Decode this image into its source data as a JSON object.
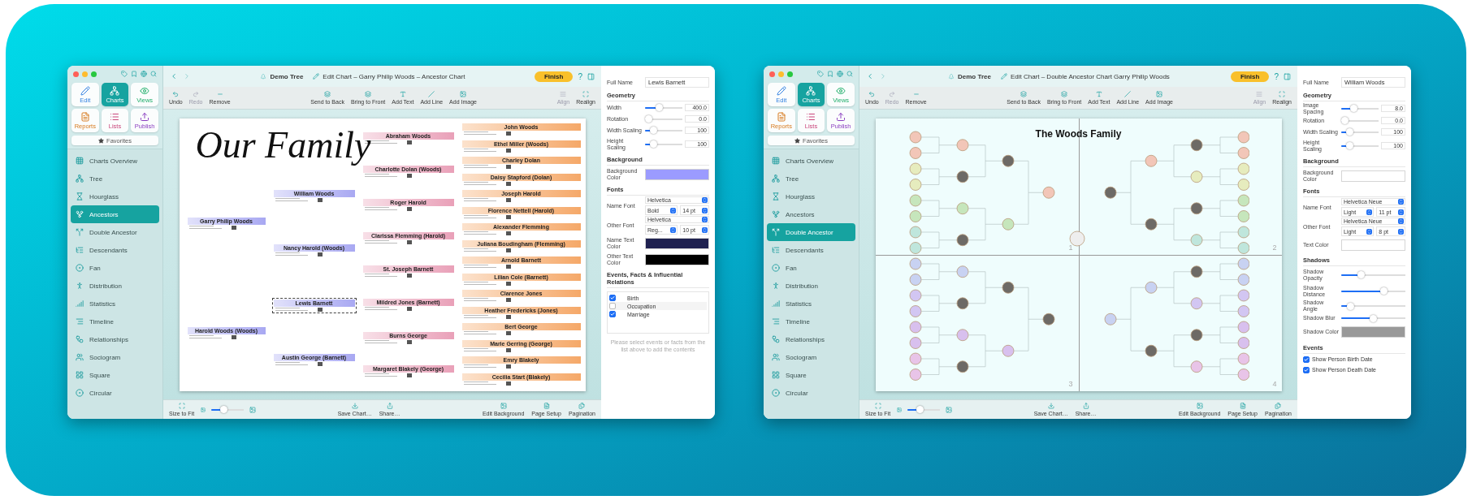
{
  "windows": [
    {
      "tree": "Demo Tree",
      "title": "Edit Chart – Garry Philip Woods – Ancestor Chart",
      "finish": "Finish",
      "help": "?",
      "modules": [
        {
          "label": "Edit",
          "selected": false
        },
        {
          "label": "Charts",
          "selected": true
        },
        {
          "label": "Views",
          "selected": false
        },
        {
          "label": "Reports",
          "selected": false
        },
        {
          "label": "Lists",
          "selected": false
        },
        {
          "label": "Publish",
          "selected": false
        }
      ],
      "favorites": "Favorites",
      "sidebar": {
        "items": [
          {
            "label": "Charts Overview",
            "selected": false
          },
          {
            "label": "Tree",
            "selected": false
          },
          {
            "label": "Hourglass",
            "selected": false
          },
          {
            "label": "Ancestors",
            "selected": true
          },
          {
            "label": "Double Ancestor",
            "selected": false
          },
          {
            "label": "Descendants",
            "selected": false
          },
          {
            "label": "Fan",
            "selected": false
          },
          {
            "label": "Distribution",
            "selected": false
          },
          {
            "label": "Statistics",
            "selected": false
          },
          {
            "label": "Timeline",
            "selected": false
          },
          {
            "label": "Relationships",
            "selected": false
          },
          {
            "label": "Sociogram",
            "selected": false
          },
          {
            "label": "Square",
            "selected": false
          },
          {
            "label": "Circular",
            "selected": false
          }
        ]
      },
      "toolbar": {
        "left": [
          {
            "label": "Undo",
            "disabled": false
          },
          {
            "label": "Redo",
            "disabled": true
          },
          {
            "label": "Remove",
            "disabled": false
          }
        ],
        "center": [
          {
            "label": "Send to Back",
            "disabled": false
          },
          {
            "label": "Bring to Front",
            "disabled": false
          },
          {
            "label": "Add Text",
            "disabled": false
          },
          {
            "label": "Add Line",
            "disabled": false
          },
          {
            "label": "Add Image",
            "disabled": false
          }
        ],
        "right": [
          {
            "label": "Align",
            "disabled": true
          },
          {
            "label": "Realign",
            "disabled": false
          }
        ]
      },
      "chart": {
        "kind": "ancestor",
        "title": "Our Family",
        "generations": [
          [
            {
              "name": "Garry Philip Woods",
              "selected": false
            },
            {
              "name": "Harold Woods (Woods)",
              "selected": false
            }
          ],
          [
            {
              "name": "William Woods",
              "selected": false
            },
            {
              "name": "Nancy Harold (Woods)",
              "selected": false
            },
            {
              "name": "Lewis Barnett",
              "selected": true
            },
            {
              "name": "Austin George (Barnett)",
              "selected": false
            }
          ],
          [
            {
              "name": "Abraham Woods",
              "selected": false
            },
            {
              "name": "Charlotte Dolan (Woods)",
              "selected": false
            },
            {
              "name": "Roger Harold",
              "selected": false
            },
            {
              "name": "Clarissa Flemming (Harold)",
              "selected": false
            },
            {
              "name": "St. Joseph Barnett",
              "selected": false
            },
            {
              "name": "Mildred Jones (Barnett)",
              "selected": false
            },
            {
              "name": "Burns George",
              "selected": false
            },
            {
              "name": "Margaret Blakely (George)",
              "selected": false
            }
          ],
          [
            {
              "name": "John Woods",
              "selected": false
            },
            {
              "name": "Ethel Miller (Woods)",
              "selected": false
            },
            {
              "name": "Charley Dolan",
              "selected": false
            },
            {
              "name": "Daisy Stapford (Dolan)",
              "selected": false
            },
            {
              "name": "Joseph Harold",
              "selected": false
            },
            {
              "name": "Florence Nettell (Harold)",
              "selected": false
            },
            {
              "name": "Alexander Flemming",
              "selected": false
            },
            {
              "name": "Juliana Boudingham (Flemming)",
              "selected": false
            },
            {
              "name": "Arnold Barnett",
              "selected": false
            },
            {
              "name": "Lilian Cole (Barnett)",
              "selected": false
            },
            {
              "name": "Clarence Jones",
              "selected": false
            },
            {
              "name": "Heather Fredericks (Jones)",
              "selected": false
            },
            {
              "name": "Bert George",
              "selected": false
            },
            {
              "name": "Marie Gerring (George)",
              "selected": false
            },
            {
              "name": "Emry Blakely",
              "selected": false
            },
            {
              "name": "Cecilia Start (Blakely)",
              "selected": false
            }
          ]
        ]
      },
      "bottom": {
        "fit": "Size to Fit",
        "zoom": {
          "level": 0.35
        },
        "center": [
          "Save Chart…",
          "Share…"
        ],
        "right": [
          "Edit Background",
          "Page Setup",
          "Pagination"
        ]
      },
      "inspector": {
        "full_name_label": "Full Name",
        "full_name": "Lewis Barnett",
        "sections": [
          {
            "title": "Geometry",
            "rows": [
              {
                "kind": "slider",
                "label": "Width",
                "level": 0.35,
                "value": "400.0"
              },
              {
                "kind": "slider",
                "label": "Rotation",
                "level": 0,
                "value": "0.0"
              },
              {
                "kind": "slider",
                "label": "Width Scaling",
                "level": 0.15,
                "value": "100"
              },
              {
                "kind": "slider",
                "label": "Height Scaling",
                "level": 0.15,
                "value": "100"
              }
            ]
          },
          {
            "title": "Background",
            "rows": [
              {
                "kind": "color",
                "label": "Background Color",
                "color": "#9b9bff"
              }
            ]
          },
          {
            "title": "Fonts",
            "rows": [
              {
                "kind": "font",
                "label": "Name Font",
                "family": "Helvetica",
                "style": "Bold",
                "size": "14 pt"
              },
              {
                "kind": "font",
                "label": "Other Font",
                "family": "Helvetica",
                "style": "Reg...",
                "size": "10 pt"
              },
              {
                "kind": "color",
                "label": "Name Text Color",
                "color": "#1f2150"
              },
              {
                "kind": "color",
                "label": "Other Text Color",
                "color": "#000000"
              }
            ]
          },
          {
            "title": "Events, Facts & Influential Relations",
            "rows": [
              {
                "kind": "checklist",
                "items": [
                  {
                    "label": "Birth",
                    "checked": true
                  },
                  {
                    "label": "Occupation",
                    "checked": false
                  },
                  {
                    "label": "Marriage",
                    "checked": true
                  }
                ]
              },
              {
                "kind": "note",
                "text": "Please select events or facts from the list above to add the contents"
              }
            ]
          }
        ]
      }
    },
    {
      "tree": "Demo Tree",
      "title": "Edit Chart – Double Ancestor Chart Garry Philip Woods",
      "finish": "Finish",
      "help": "?",
      "modules": [
        {
          "label": "Edit",
          "selected": false
        },
        {
          "label": "Charts",
          "selected": true
        },
        {
          "label": "Views",
          "selected": false
        },
        {
          "label": "Reports",
          "selected": false
        },
        {
          "label": "Lists",
          "selected": false
        },
        {
          "label": "Publish",
          "selected": false
        }
      ],
      "favorites": "Favorites",
      "sidebar": {
        "items": [
          {
            "label": "Charts Overview",
            "selected": false
          },
          {
            "label": "Tree",
            "selected": false
          },
          {
            "label": "Hourglass",
            "selected": false
          },
          {
            "label": "Ancestors",
            "selected": false
          },
          {
            "label": "Double Ancestor",
            "selected": true
          },
          {
            "label": "Descendants",
            "selected": false
          },
          {
            "label": "Fan",
            "selected": false
          },
          {
            "label": "Distribution",
            "selected": false
          },
          {
            "label": "Statistics",
            "selected": false
          },
          {
            "label": "Timeline",
            "selected": false
          },
          {
            "label": "Relationships",
            "selected": false
          },
          {
            "label": "Sociogram",
            "selected": false
          },
          {
            "label": "Square",
            "selected": false
          },
          {
            "label": "Circular",
            "selected": false
          }
        ]
      },
      "toolbar": {
        "left": [
          {
            "label": "Undo",
            "disabled": false
          },
          {
            "label": "Redo",
            "disabled": true
          },
          {
            "label": "Remove",
            "disabled": false
          }
        ],
        "center": [
          {
            "label": "Send to Back",
            "disabled": false
          },
          {
            "label": "Bring to Front",
            "disabled": false
          },
          {
            "label": "Add Text",
            "disabled": false
          },
          {
            "label": "Add Line",
            "disabled": false
          },
          {
            "label": "Add Image",
            "disabled": false
          }
        ],
        "right": [
          {
            "label": "Align",
            "disabled": true
          },
          {
            "label": "Realign",
            "disabled": false
          }
        ]
      },
      "chart": {
        "kind": "double_ancestor",
        "title": "The Woods Family",
        "quadrants": [
          "1",
          "2",
          "3",
          "4"
        ]
      },
      "bottom": {
        "fit": "Size to Fit",
        "zoom": {
          "level": 0.35
        },
        "center": [
          "Save Chart…",
          "Share…"
        ],
        "right": [
          "Edit Background",
          "Page Setup",
          "Pagination"
        ]
      },
      "inspector": {
        "full_name_label": "Full Name",
        "full_name": "William Woods",
        "sections": [
          {
            "title": "Geometry",
            "rows": [
              {
                "kind": "slider",
                "label": "Image Spacing",
                "level": 0.3,
                "value": "8.0"
              },
              {
                "kind": "slider",
                "label": "Rotation",
                "level": 0,
                "value": "0.0"
              },
              {
                "kind": "slider",
                "label": "Width Scaling",
                "level": 0.15,
                "value": "100"
              },
              {
                "kind": "slider",
                "label": "Height Scaling",
                "level": 0.15,
                "value": "100"
              }
            ]
          },
          {
            "title": "Background",
            "rows": [
              {
                "kind": "color",
                "label": "Background Color",
                "color": "#ffffff"
              }
            ]
          },
          {
            "title": "Fonts",
            "rows": [
              {
                "kind": "font",
                "label": "Name Font",
                "family": "Helvetica Neue",
                "style": "Light",
                "size": "11 pt"
              },
              {
                "kind": "font",
                "label": "Other Font",
                "family": "Helvetica Neue",
                "style": "Light",
                "size": "8 pt"
              },
              {
                "kind": "color",
                "label": "Text Color",
                "color": "#ffffff"
              }
            ]
          },
          {
            "title": "Shadows",
            "rows": [
              {
                "kind": "slider",
                "label": "Shadow Opacity",
                "level": 0.28
              },
              {
                "kind": "slider",
                "label": "Shadow Distance",
                "level": 0.68
              },
              {
                "kind": "slider",
                "label": "Shadow Angle",
                "level": 0.1
              },
              {
                "kind": "slider",
                "label": "Shadow Blur",
                "level": 0.5
              },
              {
                "kind": "color",
                "label": "Shadow Color",
                "color": "#999999"
              }
            ]
          },
          {
            "title": "Events",
            "rows": [
              {
                "kind": "checkbox",
                "label": "Show Person Birth Date",
                "checked": true
              },
              {
                "kind": "checkbox",
                "label": "Show Person Death Date",
                "checked": true
              }
            ]
          }
        ]
      }
    }
  ]
}
